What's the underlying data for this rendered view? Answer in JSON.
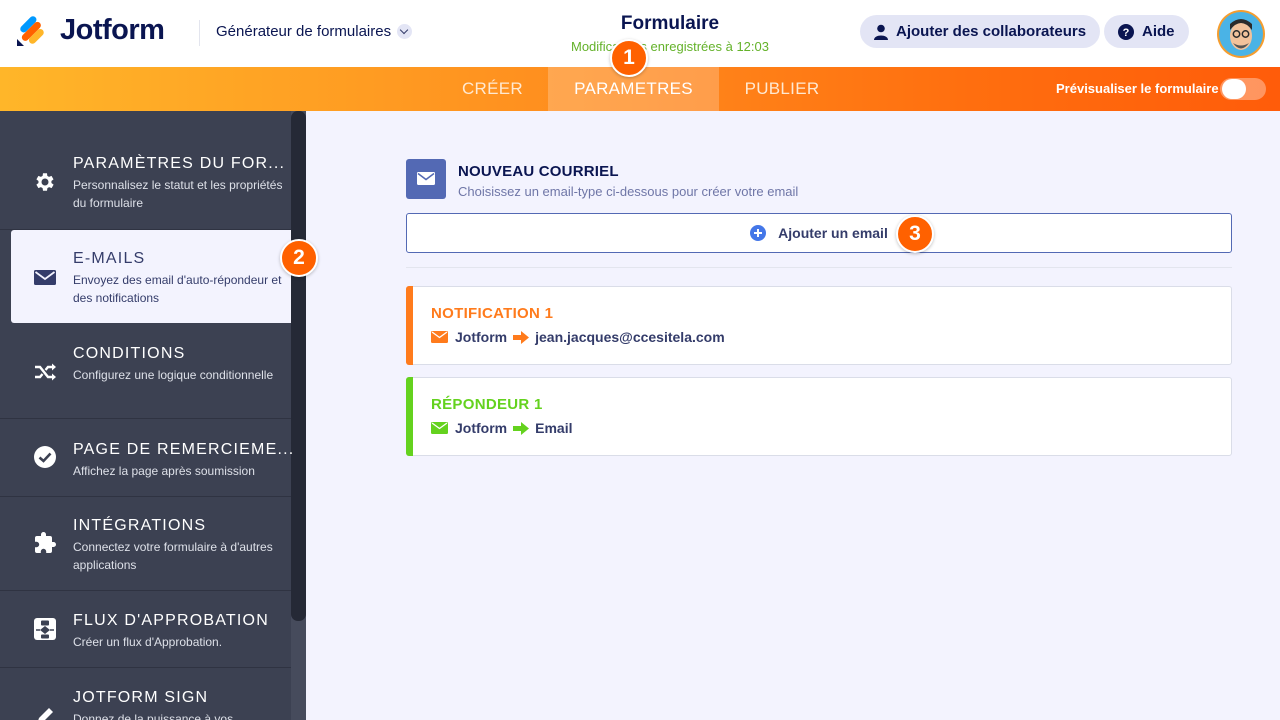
{
  "header": {
    "brand": "Jotform",
    "builder_label": "Générateur de formulaires",
    "form_title": "Formulaire",
    "saved_status": "Modifications enregistrées à 12:03",
    "collab_label": "Ajouter des collaborateurs",
    "help_label": "Aide"
  },
  "nav": {
    "tabs": [
      "CRÉER",
      "PARAMETRES",
      "PUBLIER"
    ],
    "active_tab": "PARAMETRES",
    "preview_label": "Prévisualiser le formulaire",
    "preview_enabled": false
  },
  "badges": [
    "1",
    "2",
    "3"
  ],
  "sidebar": {
    "items": [
      {
        "title": "PARAMÈTRES DU FOR...",
        "desc": "Personnalisez le statut et les propriétés du formulaire",
        "icon": "gear-icon"
      },
      {
        "title": "E-MAILS",
        "desc": "Envoyez des email d'auto-répondeur et des notifications",
        "icon": "envelope-icon"
      },
      {
        "title": "CONDITIONS",
        "desc": "Configurez une logique conditionnelle",
        "icon": "shuffle-icon"
      },
      {
        "title": "PAGE DE REMERCIEME...",
        "desc": "Affichez la page après soumission",
        "icon": "check-circle-icon"
      },
      {
        "title": "INTÉGRATIONS",
        "desc": "Connectez votre formulaire à d'autres applications",
        "icon": "puzzle-icon"
      },
      {
        "title": "FLUX D'APPROBATION",
        "desc": "Créer un flux d'Approbation.",
        "icon": "flow-icon"
      },
      {
        "title": "JOTFORM SIGN",
        "desc": "Donnez de la puissance à vos",
        "icon": "pen-icon"
      }
    ],
    "active_index": 1
  },
  "main": {
    "new_email_title": "NOUVEAU COURRIEL",
    "new_email_desc": "Choisissez un email-type ci-dessous pour créer votre email",
    "add_email_label": "Ajouter un email",
    "cards": [
      {
        "title": "NOTIFICATION 1",
        "from": "Jotform",
        "to": "jean.jacques@ccesitela.com",
        "color": "#ff7b1c"
      },
      {
        "title": "RÉPONDEUR 1",
        "from": "Jotform",
        "to": "Email",
        "color": "#64d21e"
      }
    ]
  },
  "colors": {
    "brand_navy": "#0a1551",
    "orange": "#ff6100",
    "sidebar_bg": "#3c4152",
    "main_bg": "#f3f3fe"
  }
}
